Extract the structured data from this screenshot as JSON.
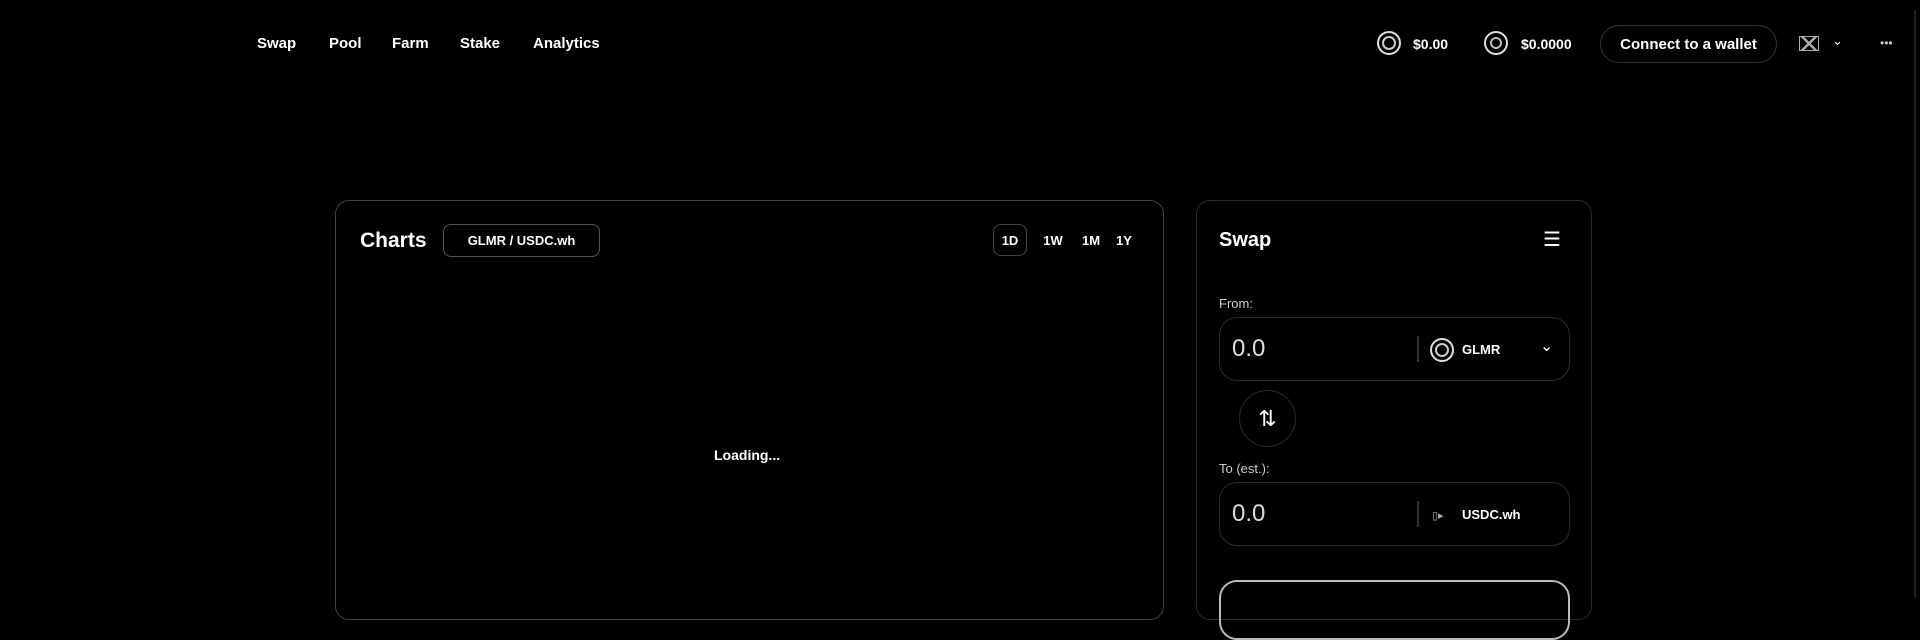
{
  "nav": {
    "items": [
      "Swap",
      "Pool",
      "Farm",
      "Stake",
      "Analytics"
    ]
  },
  "header": {
    "price1": "$0.00",
    "price2": "$0.0000",
    "connect_label": "Connect to a wallet",
    "more": "•••"
  },
  "charts": {
    "title": "Charts",
    "pair": "GLMR / USDC.wh",
    "timeframes": [
      "1D",
      "1W",
      "1M",
      "1Y"
    ],
    "active_timeframe": "1D",
    "loading": "Loading..."
  },
  "swap": {
    "title": "Swap",
    "from_label": "From:",
    "from_value": "0.0",
    "from_token": "GLMR",
    "to_label": "To (est.):",
    "to_value": "0.0",
    "to_token": "USDC.wh"
  }
}
